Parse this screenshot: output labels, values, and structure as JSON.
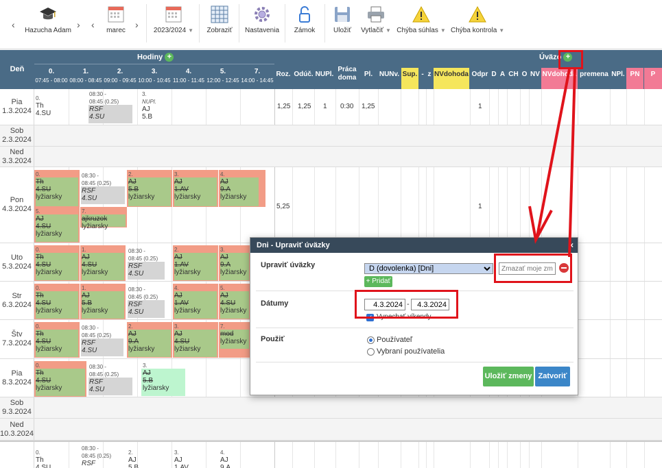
{
  "toolbar": {
    "teacher": "Hazucha Adam",
    "month": "marec",
    "year": "2023/2024",
    "show": "Zobraziť",
    "settings": "Nastavenia",
    "lock": "Zámok",
    "save": "Uložiť",
    "print": "Vytlačiť",
    "err_consent": "Chýba súhlas",
    "err_control": "Chýba kontrola",
    "arrow_left": "‹",
    "arrow_right": "›"
  },
  "header": {
    "day": "Deň",
    "hours": "Hodiny",
    "uvazok": "Úväzo",
    "lessons": [
      {
        "num": "0.",
        "time": "07:45 - 08:00"
      },
      {
        "num": "1.",
        "time": "08:00 - 08:45"
      },
      {
        "num": "2.",
        "time": "09:00 - 09:45"
      },
      {
        "num": "3.",
        "time": "10:00 - 10:45"
      },
      {
        "num": "4.",
        "time": "11:00 - 11:45"
      },
      {
        "num": "5.",
        "time": "12:00 - 12:45"
      },
      {
        "num": "7.",
        "time": "14:00 - 14:45"
      }
    ],
    "cols": {
      "roz": "Roz.",
      "oduc": "Odúč.",
      "nupl": "NUPl.",
      "praca1": "Práca",
      "praca2": "doma",
      "pl": "Pl.",
      "nunv": "NUNv.",
      "sup": "Sup.",
      "dash": "-",
      "z": "z",
      "nvdohoda": "NVdohoda",
      "odpr": "Odpr",
      "d": "D",
      "a": "A",
      "ch": "CH",
      "o": "O",
      "nv": "NV",
      "nvdohoda2": "NVdohoda",
      "premena": "premena",
      "npl": "NPl.",
      "pn": "PN",
      "p": "P"
    }
  },
  "days": [
    {
      "name": "Pia",
      "date": "1.3.2024"
    },
    {
      "name": "Sob",
      "date": "2.3.2024"
    },
    {
      "name": "Ned",
      "date": "3.3.2024"
    },
    {
      "name": "Pon",
      "date": "4.3.2024"
    },
    {
      "name": "Uto",
      "date": "5.3.2024"
    },
    {
      "name": "Str",
      "date": "6.3.2024"
    },
    {
      "name": "Štv",
      "date": "7.3.2024"
    },
    {
      "name": "Pia",
      "date": "8.3.2024"
    },
    {
      "name": "Sob",
      "date": "9.3.2024"
    },
    {
      "name": "Ned",
      "date": "10.3.2024"
    }
  ],
  "lessons": {
    "n0": "0.",
    "n1": "1.",
    "n2": "2.",
    "n3": "3.",
    "n4": "4.",
    "n5": "5.",
    "n7": "7.",
    "th": "Th",
    "su4": "4.SU",
    "aj": "AJ",
    "b5": "5.B",
    "a9": "9.A",
    "av1": "1.AV",
    "su4b": "4.SU",
    "lyziarsky": "lyžiarsky",
    "ajkruzok": "ajkruzok",
    "mod": "mod",
    "nupl": "NUPl.",
    "rsf_time1": "08:30 -",
    "rsf_time2": "08:45 (0.25)",
    "rsf": "RSF"
  },
  "row1vals": {
    "roz": "1,25",
    "oduc": "1,25",
    "nupl": "1",
    "praca": "0:30",
    "pl": "1,25",
    "odpr": "1"
  },
  "row4vals": {
    "roz": "5,25",
    "odpr": "1"
  },
  "modal": {
    "title": "Dni - Upraviť úväzky",
    "close": "×",
    "label_edit": "Upraviť úväzky",
    "select_value": "D (dovolenka) [Dni]",
    "delete_placeholder": "Zmazať moje zmeny",
    "add": "+ Pridať",
    "label_dates": "Dátumy",
    "date_from": "4.3.2024",
    "date_to": "4.3.2024",
    "date_sep": "-",
    "checkbox_label": "Vynechať víkendy",
    "label_use": "Použiť",
    "radio_user": "Používateľ",
    "radio_selected": "Vybraní používatelia",
    "save": "Uložiť zmeny",
    "close_btn": "Zatvoriť"
  },
  "colors": {
    "header": "#4a6b86",
    "green": "#5cb85c",
    "blue": "#337ab7",
    "orange": "#f29c86",
    "lesson_green": "#a9c98a",
    "red": "#e0131b"
  }
}
